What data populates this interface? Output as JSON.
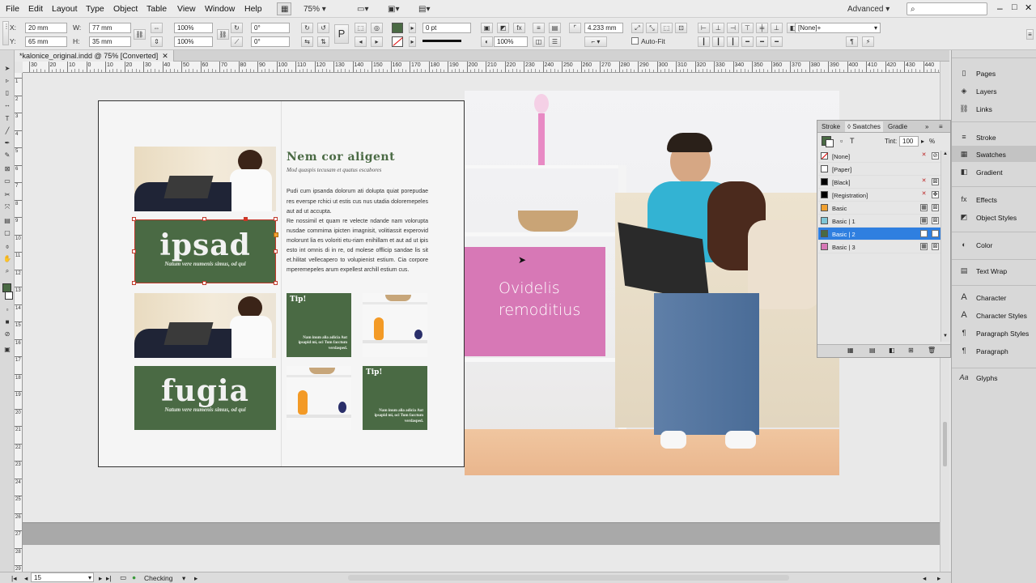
{
  "menu": {
    "items": [
      "File",
      "Edit",
      "Layout",
      "Type",
      "Object",
      "Table",
      "View",
      "Window",
      "Help"
    ],
    "zoom": "75%",
    "workspace": "Advanced",
    "search_placeholder": ""
  },
  "control": {
    "x": "20 mm",
    "y": "65 mm",
    "w": "77 mm",
    "h": "35 mm",
    "scale_x": "100%",
    "scale_y": "100%",
    "rotate": "0°",
    "shear": "0°",
    "stroke_weight": "0 pt",
    "opacity": "100%",
    "offset": "4.233 mm",
    "autofit": "Auto-Fit",
    "object_style": "[None]+",
    "labels": {
      "x": "X:",
      "y": "Y:",
      "w": "W:",
      "h": "H:"
    }
  },
  "document": {
    "tab_title": "*kalonice_original.indd @ 75% [Converted]",
    "ruler_marks": [
      "30",
      "20",
      "10",
      "0",
      "10",
      "20",
      "30",
      "40",
      "50",
      "60",
      "70",
      "80",
      "90",
      "100",
      "110",
      "120",
      "130",
      "140",
      "150",
      "160",
      "170",
      "180",
      "190",
      "200",
      "210",
      "220",
      "230",
      "240",
      "250",
      "260",
      "270",
      "280",
      "290",
      "300",
      "310",
      "320",
      "330",
      "340",
      "350",
      "360",
      "370",
      "380",
      "390",
      "400",
      "410",
      "420",
      "430",
      "440",
      "450"
    ],
    "vruler_marks": [
      "1",
      "2",
      "3",
      "4",
      "5",
      "6",
      "7",
      "8",
      "9",
      "10",
      "11",
      "12",
      "13",
      "14",
      "15",
      "16",
      "17",
      "18",
      "19",
      "20",
      "21",
      "22",
      "23",
      "24",
      "25",
      "26",
      "27",
      "28",
      "29"
    ]
  },
  "spread": {
    "heading": "Nem cor aligent",
    "subheading": "Mod quaspis tecusam et quatus escabores",
    "para1": "Pudi cum ipsanda dolorum ati dolupta quiat porepudae res everspe rchici ut estis cus nus utadia doloremepeles aut ad ut accupta.",
    "para2": "Re nossimil et quam re velecte ndande nam volorupta nusdae commima ipicten imagnisit, volitiassit experovid molorunt lia es voloriti etu-riam enihillam et aut ad ut ipis esto int omnis di in re, od molese offlicip sandae lis sit et.hilitat vellecapero to volupienist estium. Cia corpore mperemepeles arum expellest archill estium cus.",
    "box1_big": "ipsad",
    "box1_caption": "Natum vere numenis simus, od qui",
    "box2_big": "fugia",
    "box2_caption": "Natum vere numenis simus, od qui",
    "tip_label": "Tip!",
    "tip_text": "Nam inum alia adicia Aut ipsapid mi, oci Tum facctum verdasped.",
    "tip2_label": "Tip!",
    "tip2_text": "Nam inum alia adicia Aut ipsapid mi, oci Tum facctum verdasped.",
    "pink_text": "Ovidelis remoditius"
  },
  "swatches": {
    "tabs": [
      "Stroke",
      "Swatches",
      "Gradie"
    ],
    "tint_label": "Tint:",
    "tint_value": "100",
    "tint_unit": "%",
    "items": [
      {
        "name": "[None]",
        "color": "#ffffff"
      },
      {
        "name": "[Paper]",
        "color": "#ffffff"
      },
      {
        "name": "[Black]",
        "color": "#000000"
      },
      {
        "name": "[Registration]",
        "color": "#000000"
      },
      {
        "name": "Basic",
        "color": "#f0a030"
      },
      {
        "name": "Basic | 1",
        "color": "#7fc6d6"
      },
      {
        "name": "Basic | 2",
        "color": "#4a6a44"
      },
      {
        "name": "Basic | 3",
        "color": "#d778b6"
      }
    ],
    "selected_index": 6
  },
  "panels": {
    "items": [
      "Pages",
      "Layers",
      "Links",
      "Stroke",
      "Swatches",
      "Gradient",
      "Effects",
      "Object Styles",
      "Color",
      "Text Wrap",
      "Character",
      "Character Styles",
      "Paragraph Styles",
      "Paragraph",
      "Glyphs"
    ]
  },
  "status": {
    "page": "15",
    "preflight": "Checking"
  },
  "colors": {
    "green": "#4a6a44",
    "pink": "#d778b6",
    "selection": "#2f7fe0"
  }
}
